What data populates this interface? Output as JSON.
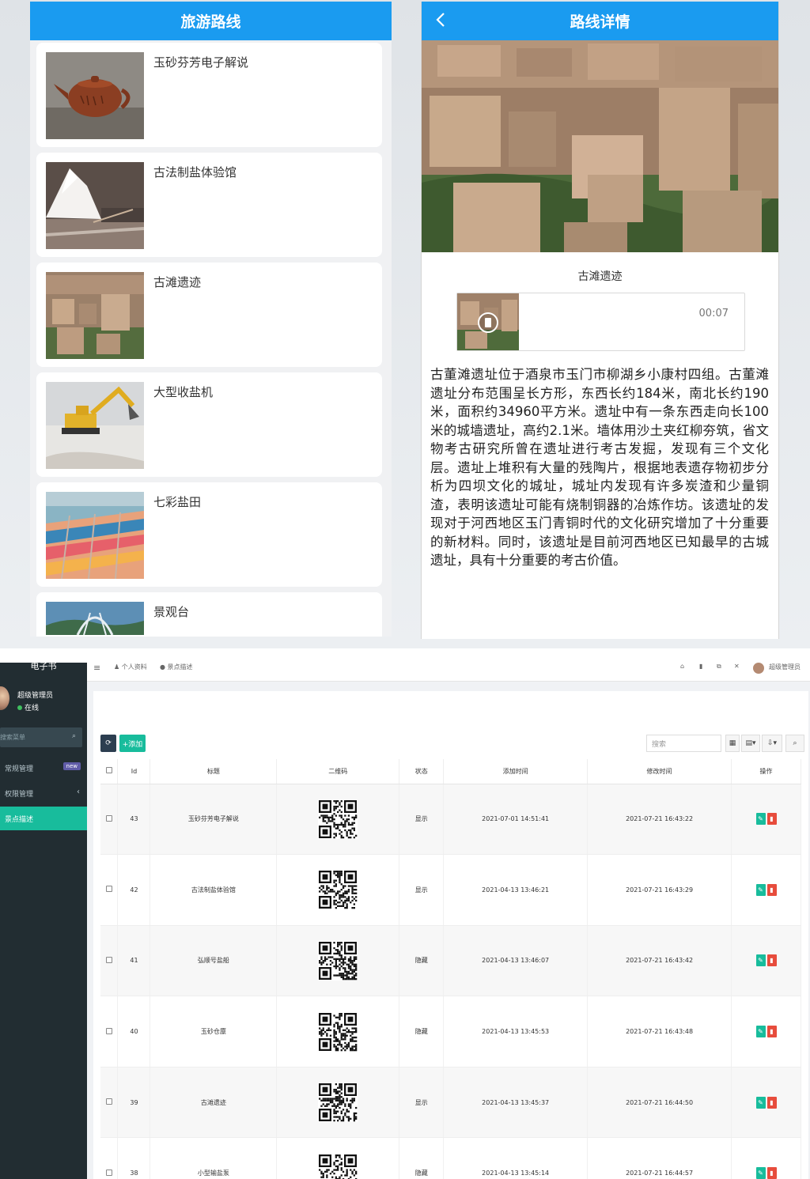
{
  "list_screen": {
    "title": "旅游路线",
    "routes": [
      {
        "name": "玉砂芬芳电子解说",
        "thumb": "teapot-photo"
      },
      {
        "name": "古法制盐体验馆",
        "thumb": "salt-pile-photo"
      },
      {
        "name": "古滩遗迹",
        "thumb": "ruins-photo"
      },
      {
        "name": "大型收盐机",
        "thumb": "excavator-photo"
      },
      {
        "name": "七彩盐田",
        "thumb": "salt-field-photo"
      },
      {
        "name": "景观台",
        "thumb": "observation-deck-photo"
      }
    ]
  },
  "detail_screen": {
    "title": "路线详情",
    "back_icon": "chevron-left-icon",
    "site_name": "古滩遗迹",
    "audio_time": "00:07",
    "play_icon": "play-icon",
    "description": "古董滩遗址位于酒泉市玉门市柳湖乡小康村四组。古董滩遗址分布范围呈长方形，东西长约184米，南北长约190米，面积约34960平方米。遗址中有一条东西走向长100米的城墙遗址，高约2.1米。墙体用沙土夹红柳夯筑，省文物考古研究所曾在遗址进行考古发掘，发现有三个文化层。遗址上堆积有大量的残陶片，根据地表遗存物初步分析为四坝文化的城址，城址内发现有许多炭渣和少量铜渣，表明该遗址可能有烧制铜器的冶炼作坊。该遗址的发现对于河西地区玉门青铜时代的文化研究增加了十分重要的新材料。同时，该遗址是目前河西地区已知最早的古城遗址，具有十分重要的考古价值。"
  },
  "admin": {
    "brand": "电子书",
    "user_name": "超级管理员",
    "user_status": "在线",
    "sidebar_search_placeholder": "搜索菜单",
    "nav": [
      {
        "label": "常规管理",
        "badge": "new"
      },
      {
        "label": "权限管理",
        "chevron": "‹"
      },
      {
        "label": "景点描述",
        "active": true
      }
    ],
    "topnav": {
      "menu_icon": "≡",
      "tab_profile": "个人资料",
      "tab_scenic": "景点描述",
      "admin_label": "超级管理员"
    },
    "toolbar": {
      "refresh_icon": "refresh-icon",
      "add_label": "+添加",
      "search_placeholder": "搜索"
    },
    "table": {
      "headers": [
        "Id",
        "标题",
        "二维码",
        "状态",
        "添加时间",
        "修改时间",
        "操作"
      ],
      "rows": [
        {
          "id": "43",
          "title": "玉砂芬芳电子解说",
          "status": "显示",
          "added": "2021-07-01 14:51:41",
          "modified": "2021-07-21 16:43:22"
        },
        {
          "id": "42",
          "title": "古法制盐体验馆",
          "status": "显示",
          "added": "2021-04-13 13:46:21",
          "modified": "2021-07-21 16:43:29"
        },
        {
          "id": "41",
          "title": "弘顺号盐船",
          "status": "隐藏",
          "added": "2021-04-13 13:46:07",
          "modified": "2021-07-21 16:43:42"
        },
        {
          "id": "40",
          "title": "玉砂仓廪",
          "status": "隐藏",
          "added": "2021-04-13 13:45:53",
          "modified": "2021-07-21 16:43:48"
        },
        {
          "id": "39",
          "title": "古滩遗迹",
          "status": "显示",
          "added": "2021-04-13 13:45:37",
          "modified": "2021-07-21 16:44:50"
        },
        {
          "id": "38",
          "title": "小型输盐泵",
          "status": "隐藏",
          "added": "2021-04-13 13:45:14",
          "modified": "2021-07-21 16:44:57"
        }
      ]
    }
  }
}
